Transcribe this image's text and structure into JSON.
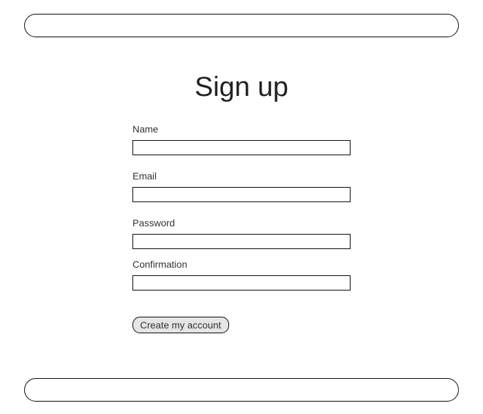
{
  "heading": "Sign up",
  "form": {
    "name_label": "Name",
    "email_label": "Email",
    "password_label": "Password",
    "confirmation_label": "Confirmation",
    "submit_label": "Create my account"
  }
}
